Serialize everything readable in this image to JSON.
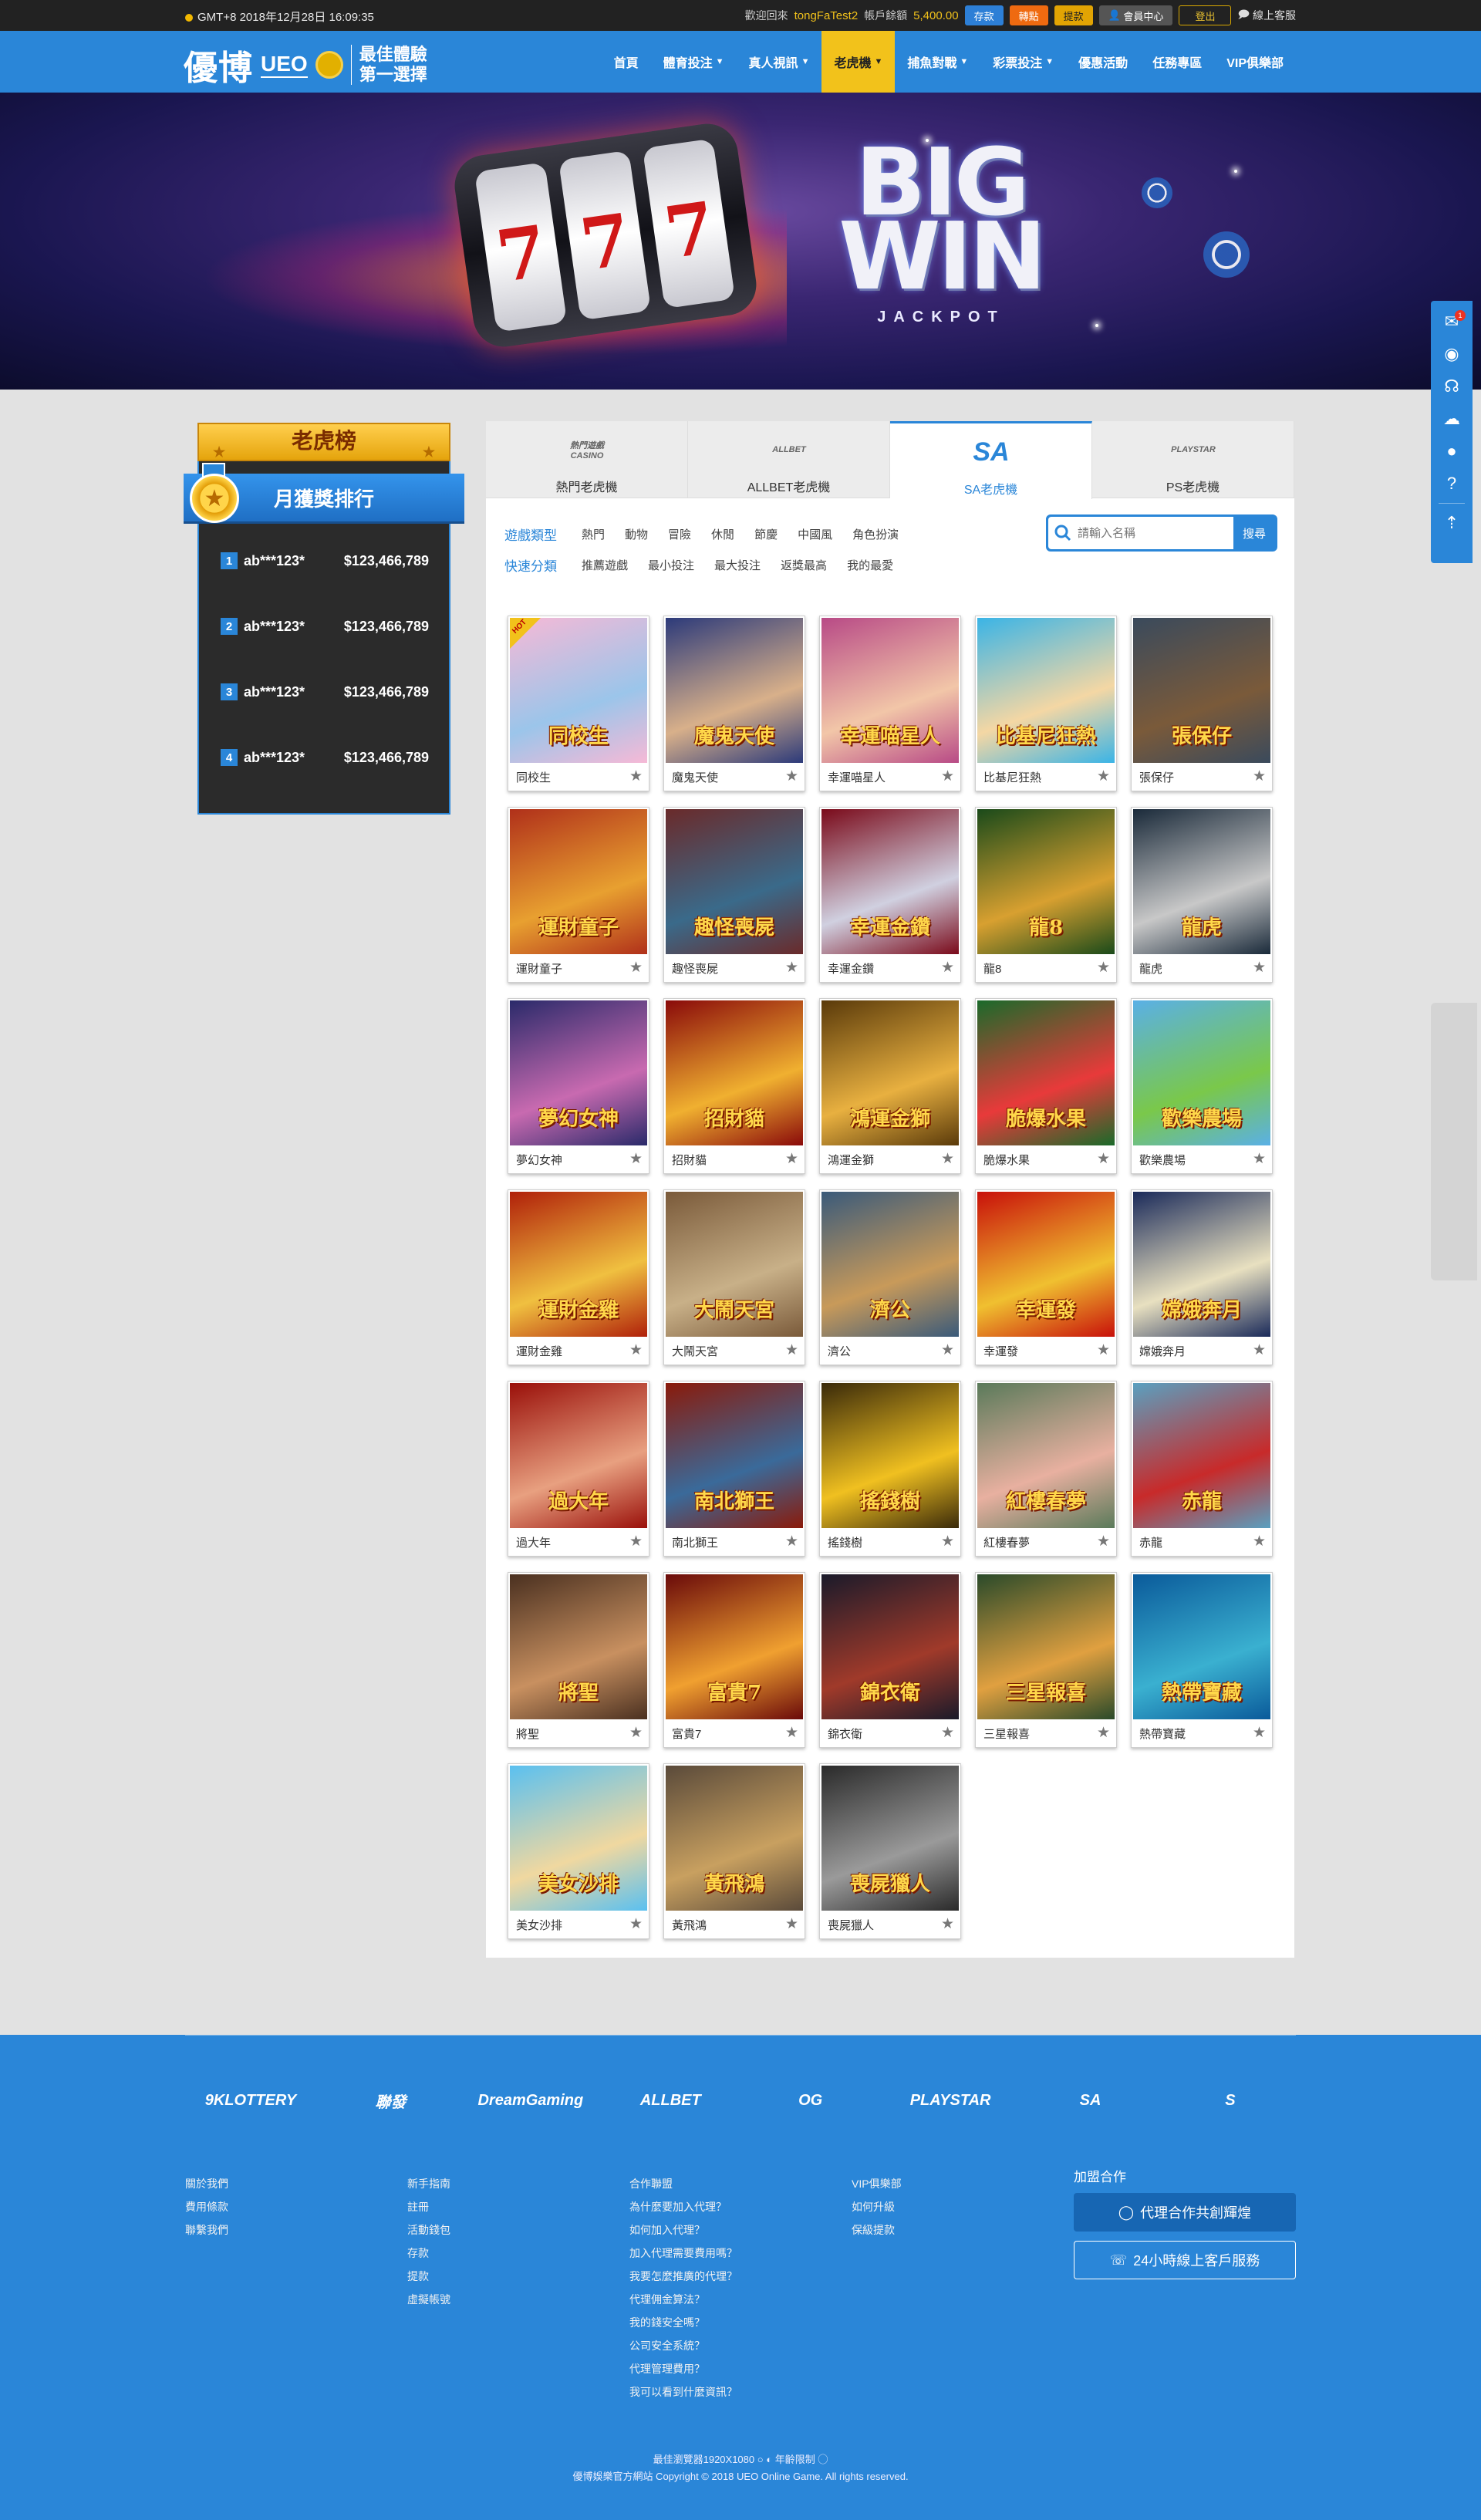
{
  "topbar": {
    "time": "GMT+8 2018年12月28日 16:09:35",
    "welcome": "歡迎回來",
    "username": "tongFaTest2",
    "balance_label": "帳戶餘額",
    "balance": "5,400.00",
    "deposit": "存款",
    "transfer": "轉點",
    "withdraw": "提款",
    "member_center": "會員中心",
    "logout": "登出",
    "online_cs": "線上客服"
  },
  "logo": {
    "mark": "優博",
    "sub": "UEO",
    "slogan1": "最佳體驗",
    "slogan2": "第一選擇"
  },
  "nav": [
    {
      "label": "首頁",
      "caret": false,
      "active": false
    },
    {
      "label": "體育投注",
      "caret": true,
      "active": false
    },
    {
      "label": "真人視訊",
      "caret": true,
      "active": false
    },
    {
      "label": "老虎機",
      "caret": true,
      "active": true
    },
    {
      "label": "捕魚對戰",
      "caret": true,
      "active": false
    },
    {
      "label": "彩票投注",
      "caret": true,
      "active": false
    },
    {
      "label": "優惠活動",
      "caret": false,
      "active": false
    },
    {
      "label": "任務專區",
      "caret": false,
      "active": false
    },
    {
      "label": "VIP俱樂部",
      "caret": false,
      "active": false
    }
  ],
  "banner": {
    "reel": "7",
    "big": "BIG",
    "win": "WIN",
    "jackpot": "JACKPOT"
  },
  "rank": {
    "title": "老虎榜",
    "subtitle": "月獲獎排行",
    "rows": [
      {
        "n": "1",
        "user": "ab***123*",
        "amount": "$123,466,789"
      },
      {
        "n": "2",
        "user": "ab***123*",
        "amount": "$123,466,789"
      },
      {
        "n": "3",
        "user": "ab***123*",
        "amount": "$123,466,789"
      },
      {
        "n": "4",
        "user": "ab***123*",
        "amount": "$123,466,789"
      }
    ]
  },
  "tabs": [
    {
      "label": "熱門老虎機",
      "logo": "熱門遊戲 CASINO"
    },
    {
      "label": "ALLBET老虎機",
      "logo": "ALLBET"
    },
    {
      "label": "SA老虎機",
      "logo": "SA"
    },
    {
      "label": "PS老虎機",
      "logo": "PLAYSTAR"
    }
  ],
  "filters": {
    "type_label": "遊戲類型",
    "types": [
      "熱門",
      "動物",
      "冒險",
      "休閒",
      "節慶",
      "中國風",
      "角色扮演"
    ],
    "quick_label": "快速分類",
    "quick": [
      "推薦遊戲",
      "最小投注",
      "最大投注",
      "返獎最高",
      "我的最愛"
    ]
  },
  "search": {
    "placeholder": "請輸入名稱",
    "button": "搜尋"
  },
  "games": [
    {
      "name": "同校生",
      "title": "同校生",
      "hot": true,
      "c1": "#f6b9d6",
      "c2": "#9bc5ea"
    },
    {
      "name": "魔鬼天使",
      "title": "魔鬼天使",
      "c1": "#2c3a7a",
      "c2": "#d8b08a"
    },
    {
      "name": "幸運喵星人",
      "title": "幸運喵星人",
      "c1": "#b84a86",
      "c2": "#f2c6a8"
    },
    {
      "name": "比基尼狂熱",
      "title": "比基尼狂熱",
      "c1": "#3ab4e6",
      "c2": "#f4d7a4"
    },
    {
      "name": "張保仔",
      "title": "張保仔",
      "c1": "#3a4a5c",
      "c2": "#7a5a3a"
    },
    {
      "name": "運財童子",
      "title": "運財童子",
      "c1": "#b0301a",
      "c2": "#e8a030"
    },
    {
      "name": "趣怪喪屍",
      "title": "趣怪喪屍",
      "c1": "#6a2a2a",
      "c2": "#3a6a8a"
    },
    {
      "name": "幸運金鑽",
      "title": "幸運金鑽",
      "c1": "#7a0a1a",
      "c2": "#d0d0e0"
    },
    {
      "name": "龍8",
      "title": "龍8",
      "c1": "#1a4a1a",
      "c2": "#d8a030"
    },
    {
      "name": "龍虎",
      "title": "龍虎",
      "c1": "#1a2a3a",
      "c2": "#c8c8c8"
    },
    {
      "name": "夢幻女神",
      "title": "夢幻女神",
      "c1": "#2a2a6a",
      "c2": "#c86ab0"
    },
    {
      "name": "招財貓",
      "title": "招財貓",
      "c1": "#8a0a0a",
      "c2": "#f0b030"
    },
    {
      "name": "鴻運金獅",
      "title": "鴻運金獅",
      "c1": "#5a3a0a",
      "c2": "#e8b040"
    },
    {
      "name": "脆爆水果",
      "title": "脆爆水果",
      "c1": "#1a6a2a",
      "c2": "#e83a3a"
    },
    {
      "name": "歡樂農場",
      "title": "歡樂農場",
      "c1": "#5ab0e6",
      "c2": "#7ac84a"
    },
    {
      "name": "運財金雞",
      "title": "運財金雞",
      "c1": "#b0200a",
      "c2": "#f0c040"
    },
    {
      "name": "大鬧天宮",
      "title": "大鬧天宮",
      "c1": "#7a5a3a",
      "c2": "#c8b088"
    },
    {
      "name": "濟公",
      "title": "濟公",
      "c1": "#3a5a7a",
      "c2": "#c89a5a"
    },
    {
      "name": "幸運發",
      "title": "幸運發",
      "c1": "#c8100a",
      "c2": "#f0c030"
    },
    {
      "name": "嫦娥奔月",
      "title": "嫦娥奔月",
      "c1": "#1a2a5a",
      "c2": "#e8e0c0"
    },
    {
      "name": "過大年",
      "title": "過大年",
      "c1": "#9a100a",
      "c2": "#e8a080"
    },
    {
      "name": "南北獅王",
      "title": "南北獅王",
      "c1": "#8a1a0a",
      "c2": "#3a6a9a"
    },
    {
      "name": "搖錢樹",
      "title": "搖錢樹",
      "c1": "#3a2a0a",
      "c2": "#f0c020"
    },
    {
      "name": "紅樓春夢",
      "title": "紅樓春夢",
      "c1": "#5a7a5a",
      "c2": "#e8b0a0"
    },
    {
      "name": "赤龍",
      "title": "赤龍",
      "c1": "#5aa0c0",
      "c2": "#c82a2a"
    },
    {
      "name": "將聖",
      "title": "將聖",
      "c1": "#4a3020",
      "c2": "#c89060"
    },
    {
      "name": "富貴7",
      "title": "富貴7",
      "c1": "#6a0a0a",
      "c2": "#f0a030"
    },
    {
      "name": "錦衣衛",
      "title": "錦衣衛",
      "c1": "#1a1a2a",
      "c2": "#a03a2a"
    },
    {
      "name": "三星報喜",
      "title": "三星報喜",
      "c1": "#2a4a2a",
      "c2": "#e0a040"
    },
    {
      "name": "熱帶寶藏",
      "title": "熱帶寶藏",
      "c1": "#0a5a9a",
      "c2": "#3ab0d0"
    },
    {
      "name": "美女沙排",
      "title": "美女沙排",
      "c1": "#5ac0f0",
      "c2": "#f0d8a0"
    },
    {
      "name": "黃飛鴻",
      "title": "黃飛鴻",
      "c1": "#5a4a3a",
      "c2": "#c8a060"
    },
    {
      "name": "喪屍獵人",
      "title": "喪屍獵人",
      "c1": "#2a2a2a",
      "c2": "#9a9a9a"
    }
  ],
  "float_icons": [
    "mail-icon",
    "wallet-icon",
    "headset-icon",
    "wechat-icon",
    "line-icon",
    "question-icon",
    "top-icon"
  ],
  "float_badge": "1",
  "partners": [
    {
      "name": "9KLOTTERY",
      "sub": ""
    },
    {
      "name": "聯發",
      "sub": ""
    },
    {
      "name": "DreamGaming",
      "sub": ""
    },
    {
      "name": "ALLBET",
      "sub": ""
    },
    {
      "name": "OG",
      "sub": ""
    },
    {
      "name": "PLAYSTAR",
      "sub": ""
    },
    {
      "name": "SA",
      "sub": ""
    },
    {
      "name": "S",
      "sub": ""
    }
  ],
  "footer": {
    "col1": [
      "關於我們",
      "費用條款",
      "聯繫我們"
    ],
    "col2": [
      "新手指南",
      "註冊",
      "活動錢包",
      "存款",
      "提款",
      "虛擬帳號"
    ],
    "col3": [
      "合作聯盟",
      "為什麼要加入代理？",
      "如何加入代理？",
      "加入代理需要費用嗎？",
      "我要怎麼推廣的代理？",
      "代理佣金算法？",
      "我的錢安全嗎？",
      "公司安全系統？",
      "代理管理費用？",
      "我可以看到什麼資訊？"
    ],
    "col4": [
      "VIP俱樂部",
      "如何升級",
      "保級提款"
    ],
    "join_title": "加盟合作",
    "join_btn1": "代理合作共創輝煌",
    "join_btn2": "24小時線上客戶服務",
    "bottom1": "最佳瀏覽器1920X1080",
    "bottom1b": "年齡限制",
    "bottom2": "優博娛樂官方網站 Copyright © 2018 UEO Online Game. All rights reserved."
  }
}
